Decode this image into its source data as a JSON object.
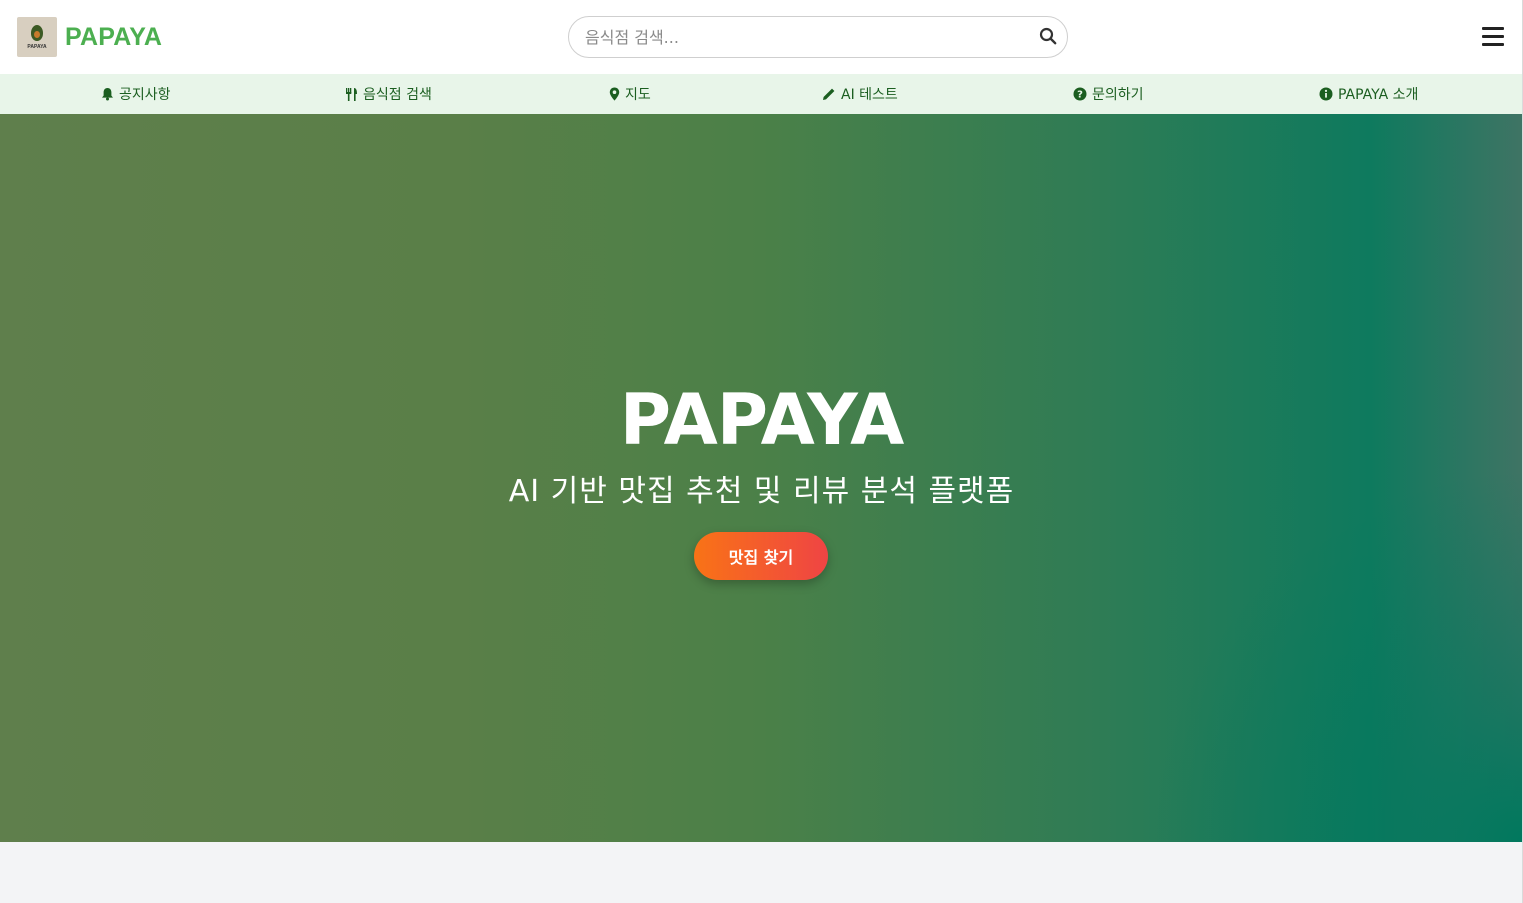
{
  "header": {
    "brand": "PAPAYA",
    "logo_text": "PAPAYA",
    "search_placeholder": "음식점 검색...",
    "search_icon": "magnifier-icon",
    "menu_icon": "hamburger-menu-icon"
  },
  "nav": {
    "items": [
      {
        "label": "공지사항",
        "icon": "bell-icon"
      },
      {
        "label": "음식점 검색",
        "icon": "utensils-icon"
      },
      {
        "label": "지도",
        "icon": "map-pin-icon"
      },
      {
        "label": "AI 테스트",
        "icon": "pencil-icon"
      },
      {
        "label": "문의하기",
        "icon": "question-circle-icon"
      },
      {
        "label": "PAPAYA 소개",
        "icon": "info-circle-icon"
      }
    ]
  },
  "hero": {
    "title": "PAPAYA",
    "subtitle": "AI 기반 맛집 추천 및 리뷰 분석 플랫폼",
    "cta_label": "맛집 찾기"
  },
  "colors": {
    "brand_green": "#4caf50",
    "nav_bg": "#e8f5e9",
    "nav_text": "#1b5e20",
    "cta_start": "#f97316",
    "cta_end": "#ef4444"
  }
}
